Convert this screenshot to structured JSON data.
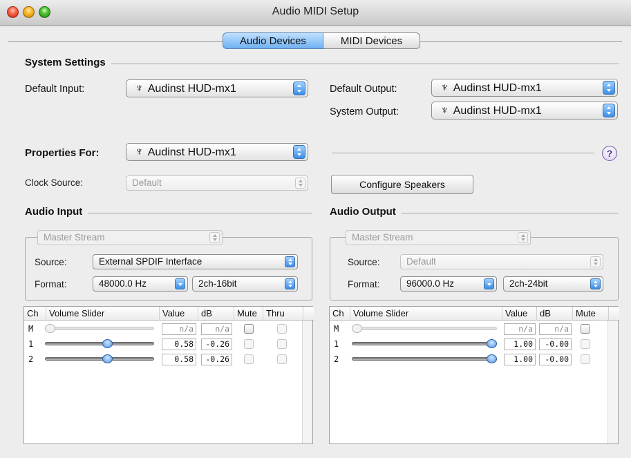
{
  "window": {
    "title": "Audio MIDI Setup"
  },
  "tabs": [
    {
      "label": "Audio Devices",
      "selected": true
    },
    {
      "label": "MIDI Devices",
      "selected": false
    }
  ],
  "system_settings": {
    "title": "System Settings",
    "default_input_label": "Default Input:",
    "default_input_value": "Audinst HUD-mx1",
    "default_output_label": "Default Output:",
    "default_output_value": "Audinst HUD-mx1",
    "system_output_label": "System Output:",
    "system_output_value": "Audinst HUD-mx1",
    "usb_glyph": "♆"
  },
  "properties": {
    "label": "Properties For:",
    "value": "Audinst HUD-mx1",
    "help": "?",
    "clock_source_label": "Clock Source:",
    "clock_source_value": "Default",
    "configure_speakers_label": "Configure Speakers"
  },
  "audio_input": {
    "title": "Audio Input",
    "stream": "Master Stream",
    "source_label": "Source:",
    "source_value": "External SPDIF Interface",
    "format_label": "Format:",
    "sample_rate": "48000.0 Hz",
    "bit_format": "2ch-16bit",
    "table": {
      "headers": [
        "Ch",
        "Volume Slider",
        "Value",
        "dB",
        "Mute",
        "Thru"
      ],
      "rows": [
        {
          "ch": "M",
          "volume": 0.0,
          "value": "n/a",
          "db": "n/a",
          "enabled": false
        },
        {
          "ch": "1",
          "volume": 0.58,
          "value": "0.58",
          "db": "-0.26",
          "enabled": true
        },
        {
          "ch": "2",
          "volume": 0.58,
          "value": "0.58",
          "db": "-0.26",
          "enabled": true
        }
      ]
    }
  },
  "audio_output": {
    "title": "Audio Output",
    "stream": "Master Stream",
    "source_label": "Source:",
    "source_value": "Default",
    "format_label": "Format:",
    "sample_rate": "96000.0 Hz",
    "bit_format": "2ch-24bit",
    "table": {
      "headers": [
        "Ch",
        "Volume Slider",
        "Value",
        "dB",
        "Mute"
      ],
      "rows": [
        {
          "ch": "M",
          "volume": 0.0,
          "value": "n/a",
          "db": "n/a",
          "enabled": false
        },
        {
          "ch": "1",
          "volume": 1.0,
          "value": "1.00",
          "db": "-0.00",
          "enabled": true
        },
        {
          "ch": "2",
          "volume": 1.0,
          "value": "1.00",
          "db": "-0.00",
          "enabled": true
        }
      ]
    }
  },
  "colors": {
    "accent": "#4d93e3",
    "window_bg": "#ededed",
    "help_border": "#7a5fa8"
  }
}
